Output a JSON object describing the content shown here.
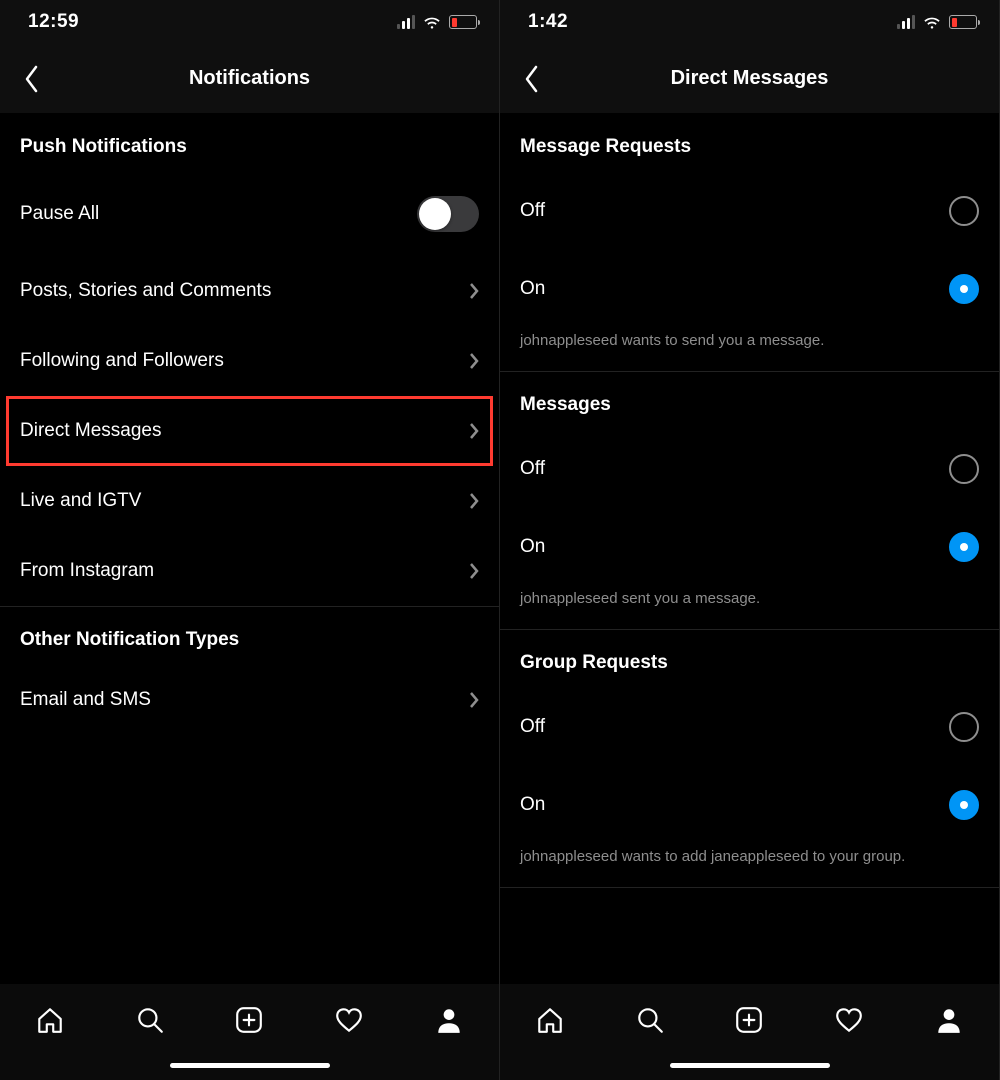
{
  "left": {
    "status": {
      "time": "12:59"
    },
    "nav_title": "Notifications",
    "section1_header": "Push Notifications",
    "pause_all_label": "Pause All",
    "rows": {
      "posts": "Posts, Stories and Comments",
      "following": "Following and Followers",
      "dm": "Direct Messages",
      "live": "Live and IGTV",
      "from_ig": "From Instagram"
    },
    "section2_header": "Other Notification Types",
    "email_sms": "Email and SMS"
  },
  "right": {
    "status": {
      "time": "1:42"
    },
    "nav_title": "Direct Messages",
    "groups": {
      "message_requests": {
        "header": "Message Requests",
        "off": "Off",
        "on": "On",
        "hint": "johnappleseed wants to send you a message."
      },
      "messages": {
        "header": "Messages",
        "off": "Off",
        "on": "On",
        "hint": "johnappleseed sent you a message."
      },
      "group_requests": {
        "header": "Group Requests",
        "off": "Off",
        "on": "On",
        "hint": "johnappleseed wants to add janeappleseed to your group."
      }
    }
  }
}
